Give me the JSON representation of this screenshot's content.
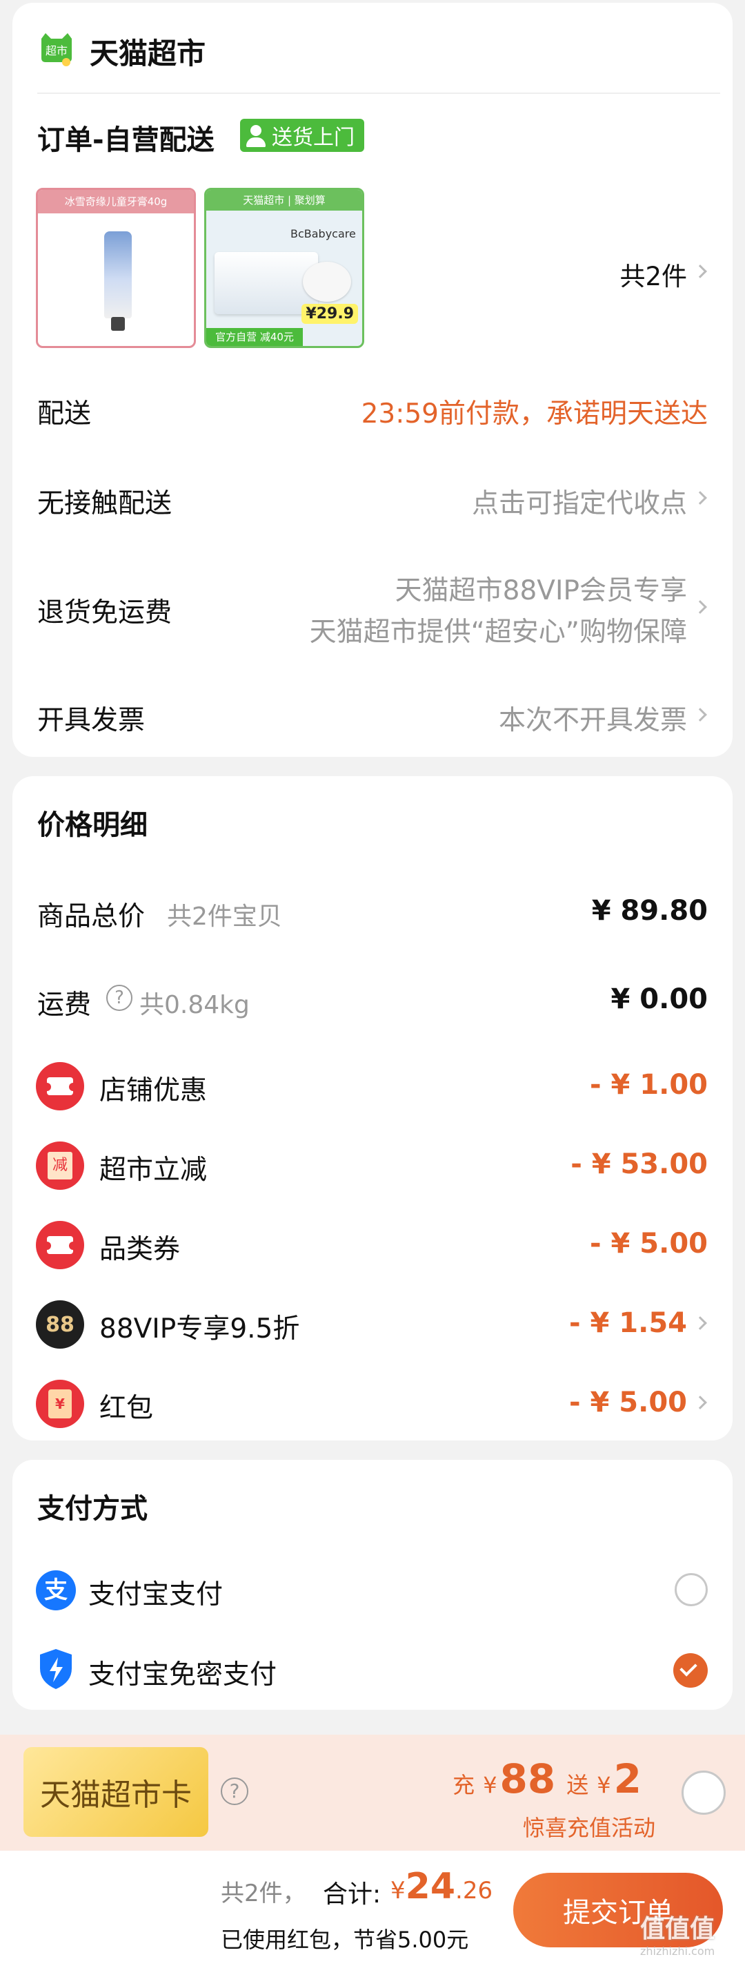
{
  "store": {
    "badge": "超市",
    "name": "天猫超市"
  },
  "order": {
    "title": "订单-自营配送",
    "delivery_tag": "送货上门",
    "product1_banner": "冰雪奇缘儿童牙膏40g",
    "product2_banner": "天猫超市 | 聚划算",
    "product2_brand": "BcBabycare",
    "product2_price_tag": "29.9",
    "product2_bottom": "官方自营 减40元",
    "item_count": "共2件"
  },
  "rows": {
    "delivery_label": "配送",
    "delivery_value": "23:59前付款，承诺明天送达",
    "contactless_label": "无接触配送",
    "contactless_value": "点击可指定代收点",
    "return_label": "退货免运费",
    "return_value_1": "天猫超市88VIP会员专享",
    "return_value_2": "天猫超市提供“超安心”购物保障",
    "invoice_label": "开具发票",
    "invoice_value": "本次不开具发票"
  },
  "price": {
    "title": "价格明细",
    "goods_label": "商品总价",
    "goods_sub": "共2件宝贝",
    "goods_value": "¥ 89.80",
    "shipping_label": "运费",
    "shipping_sub": "共0.84kg",
    "shipping_value": "¥ 0.00",
    "discounts": [
      {
        "label": "店铺优惠",
        "amount": "- ¥ 1.00",
        "icon": "coupon-icon"
      },
      {
        "label": "超市立减",
        "amount": "- ¥ 53.00",
        "icon": "reduce-icon",
        "glyph": "减"
      },
      {
        "label": "品类券",
        "amount": "- ¥ 5.00",
        "icon": "coupon-icon"
      },
      {
        "label": "88VIP专享9.5折",
        "amount": "- ¥ 1.54",
        "icon": "88vip-icon",
        "glyph": "88"
      },
      {
        "label": "红包",
        "amount": "- ¥ 5.00",
        "icon": "red-packet-icon",
        "glyph": "¥"
      }
    ]
  },
  "payment": {
    "title": "支付方式",
    "alipay": "支付宝支付",
    "alipay_glyph": "支",
    "alipay_nopwd": "支付宝免密支付"
  },
  "promo": {
    "card_label": "天猫超市卡",
    "charge_prefix": "充",
    "charge_amount": "88",
    "gift_prefix": "送",
    "gift_amount": "2",
    "yen": "¥",
    "activity": "惊喜充值活动"
  },
  "footer": {
    "count": "共2件，",
    "total_label": "合计:",
    "total_yen": "¥",
    "total_int": "24",
    "total_dec": ".26",
    "saved": "已使用红包，节省5.00元",
    "submit": "提交订单"
  },
  "watermark": {
    "text": "值值值",
    "domain": "zhizhizhi.com"
  },
  "colors": {
    "accent": "#e3632a",
    "green": "#4cbb3c",
    "alipay_blue": "#1677ff"
  }
}
